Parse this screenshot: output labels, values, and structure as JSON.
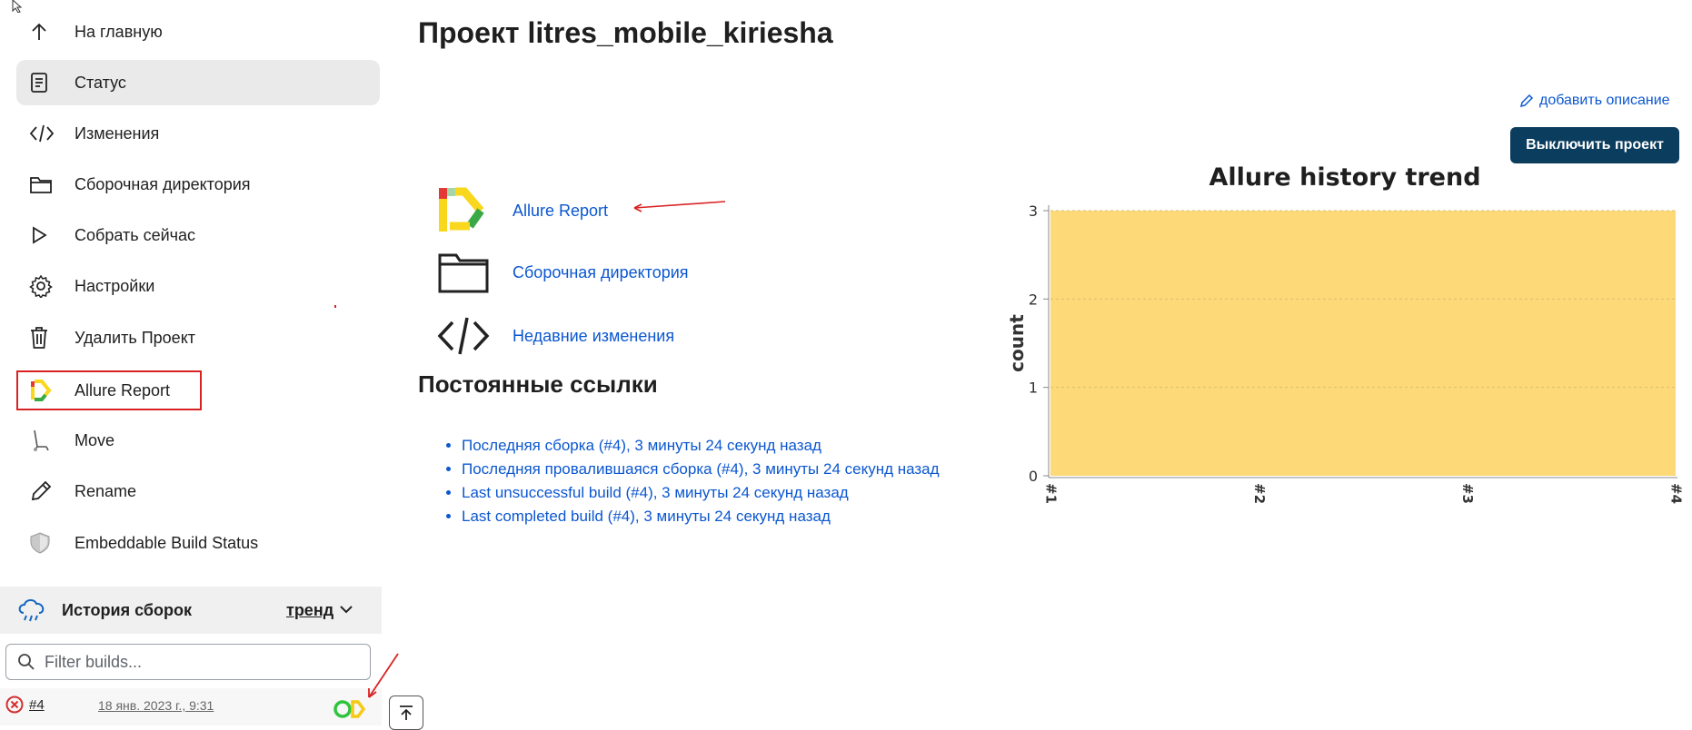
{
  "sidebar": {
    "items": [
      {
        "label": "На главную",
        "icon": "arrow-up-icon"
      },
      {
        "label": "Статус",
        "icon": "document-icon",
        "active": true
      },
      {
        "label": "Изменения",
        "icon": "code-icon"
      },
      {
        "label": "Сборочная директория",
        "icon": "folder-icon"
      },
      {
        "label": "Собрать сейчас",
        "icon": "play-icon"
      },
      {
        "label": "Настройки",
        "icon": "gear-icon"
      },
      {
        "label": "Удалить Проект",
        "icon": "trash-icon"
      },
      {
        "label": "Allure Report",
        "icon": "allure-logo-icon",
        "highlighted": true
      },
      {
        "label": "Move",
        "icon": "move-icon"
      },
      {
        "label": "Rename",
        "icon": "pencil-icon"
      },
      {
        "label": "Embeddable Build Status",
        "icon": "shield-icon"
      }
    ]
  },
  "history": {
    "title": "История сборок",
    "trend_label": "тренд",
    "filter_placeholder": "Filter builds...",
    "builds": [
      {
        "number": "#4",
        "date": "18 янв. 2023 г., 9:31",
        "status": "failed"
      }
    ]
  },
  "main": {
    "title": "Проект litres_mobile_kiriesha",
    "add_description": "добавить описание",
    "disable_button": "Выключить проект",
    "links": [
      {
        "label": "Allure Report",
        "icon": "allure-logo-icon"
      },
      {
        "label": "Сборочная директория",
        "icon": "folder-icon"
      },
      {
        "label": "Недавние изменения",
        "icon": "code-icon"
      }
    ],
    "permalinks_title": "Постоянные ссылки",
    "permalinks": [
      "Последняя сборка (#4), 3 минуты 24 секунд назад",
      "Последняя провалившаяся сборка (#4), 3 минуты 24 секунд назад",
      "Last unsuccessful build (#4), 3 минуты 24 секунд назад",
      "Last completed build (#4), 3 минуты 24 секунд назад"
    ]
  },
  "colors": {
    "accent": "#0b57d0",
    "button_dark": "#0b3d5e",
    "chart_fill": "#fdd978",
    "annotation_red": "#d92323"
  },
  "chart_data": {
    "type": "area",
    "title": "Allure history trend",
    "xlabel": "",
    "ylabel": "count",
    "categories": [
      "#1",
      "#2",
      "#3",
      "#4"
    ],
    "series": [
      {
        "values": [
          3,
          3,
          3,
          3
        ]
      }
    ],
    "ylim": [
      0,
      3
    ],
    "yticks": [
      0,
      1,
      2,
      3
    ],
    "grid": true
  }
}
